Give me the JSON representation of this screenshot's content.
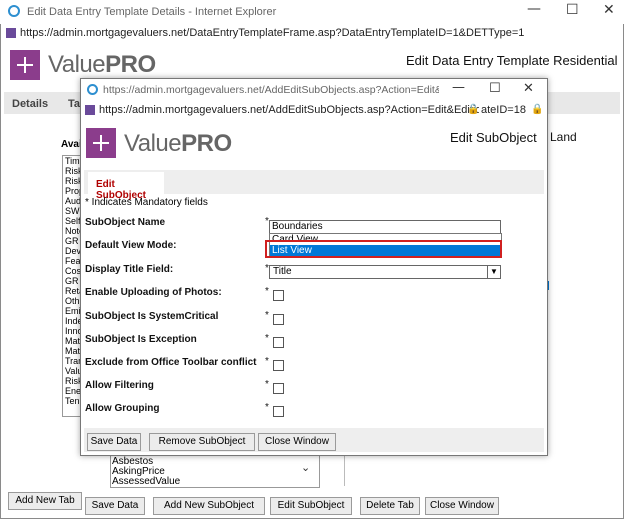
{
  "outer_window": {
    "title": "Edit Data Entry Template Details - Internet Explorer",
    "url": "https://admin.mortgagevaluers.net/DataEntryTemplateFrame.asp?DataEntryTemplateID=1&DETType=1",
    "page_title": "Edit Data Entry Template Residential",
    "logo_text_light": "Value",
    "logo_text_bold": "PRO",
    "tabs": [
      "Details",
      "Ta"
    ],
    "available_label": "Avai",
    "left_list": [
      "Tim",
      "Risk",
      "Risk",
      "Prop",
      "Aud",
      "SWC",
      "Self",
      "Note",
      "GR",
      "Dev",
      "Feat",
      "Cost",
      "GR",
      "Reta",
      "Oth",
      "Emi",
      "Inde",
      "Inno",
      "Mat",
      "Mat",
      "Tran",
      "Valu",
      "Risk",
      "Ene",
      "Ten"
    ],
    "right_fragment": "b Land",
    "bottom_list": [
      "Asbestos",
      "AskingPrice",
      "AssessedValue"
    ],
    "buttons": {
      "add_new_tab": "Add New Tab",
      "save_data": "Save Data",
      "add_new_subobject": "Add New SubObject",
      "edit_subobject": "Edit SubObject",
      "delete_tab": "Delete Tab",
      "close_window": "Close Window"
    }
  },
  "inner_window": {
    "title_url": "https://admin.mortgagevaluers.net/AddEditSubObjects.asp?Action=Edit&Edition=Sta...",
    "url": "https://admin.mortgagevaluers.net/AddEditSubObjects.asp?Action=Edit&Edition=Standard&TabID=15&SubOb",
    "url_tail": "ateID=18",
    "page_title": "Edit SubObject",
    "logo_text_light": "Value",
    "logo_text_bold": "PRO",
    "tab_label": "Edit SubObject",
    "mandatory_note": "* Indicates Mandatory fields",
    "fields": {
      "subobject_name": {
        "label": "SubObject Name",
        "value": "Boundaries"
      },
      "default_view_mode": {
        "label": "Default View Mode:",
        "options": [
          "Card View",
          "List View"
        ],
        "selected": "List View"
      },
      "display_title_field": {
        "label": "Display Title Field:",
        "value": "Title"
      },
      "enable_uploading_photos": {
        "label": "Enable Uploading of Photos:"
      },
      "system_critical": {
        "label": "SubObject Is SystemCritical"
      },
      "is_exception": {
        "label": "SubObject Is Exception"
      },
      "exclude_toolbar": {
        "label": "Exclude from Office Toolbar conflict"
      },
      "allow_filtering": {
        "label": "Allow Filtering"
      },
      "allow_grouping": {
        "label": "Allow Grouping"
      }
    },
    "asterisk": "*",
    "buttons": {
      "save_data": "Save Data",
      "remove_subobject": "Remove SubObject",
      "close_window": "Close Window"
    }
  },
  "colors": {
    "brand": "#8b3d8c",
    "highlight": "#0078d7",
    "red_outline": "#d02020",
    "accent_red": "#b00000"
  }
}
